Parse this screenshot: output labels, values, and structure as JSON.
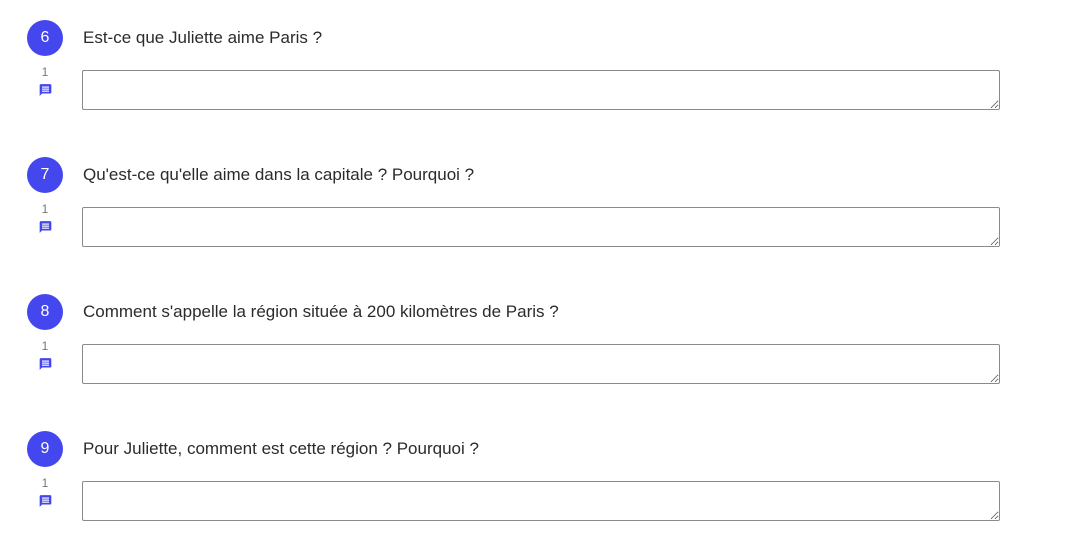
{
  "accent_color": "#4446ee",
  "questions": [
    {
      "number": "6",
      "text": "Est-ce que Juliette aime Paris ?",
      "points": "1",
      "answer": "",
      "icon": "comment-icon"
    },
    {
      "number": "7",
      "text": "Qu'est-ce qu'elle aime dans la capitale ? Pourquoi ?",
      "points": "1",
      "answer": "",
      "icon": "comment-icon"
    },
    {
      "number": "8",
      "text": "Comment s'appelle la région située à 200 kilomètres de Paris ?",
      "points": "1",
      "answer": "",
      "icon": "comment-icon"
    },
    {
      "number": "9",
      "text": "Pour Juliette, comment est cette région ? Pourquoi ?",
      "points": "1",
      "answer": "",
      "icon": "comment-icon"
    }
  ]
}
